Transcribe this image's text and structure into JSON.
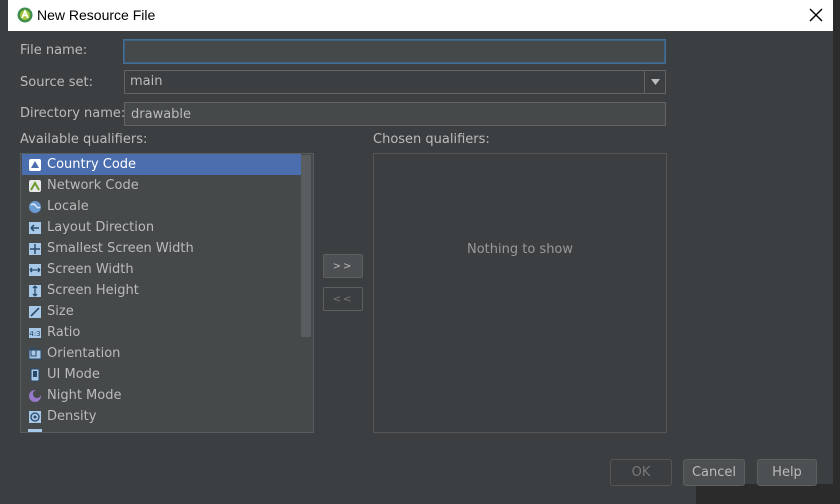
{
  "window": {
    "title": "New Resource File"
  },
  "form": {
    "file_name_label": "File name:",
    "file_name_value": "",
    "source_set_label": "Source set:",
    "source_set_value": "main",
    "directory_name_label": "Directory name:",
    "directory_name_value": "drawable"
  },
  "qualifiers": {
    "available_label": "Available qualifiers:",
    "chosen_label": "Chosen qualifiers:",
    "empty_text": "Nothing to show",
    "items": [
      {
        "label": "Country Code",
        "icon": "country-code-icon"
      },
      {
        "label": "Network Code",
        "icon": "network-code-icon"
      },
      {
        "label": "Locale",
        "icon": "globe-icon"
      },
      {
        "label": "Layout Direction",
        "icon": "layout-direction-icon"
      },
      {
        "label": "Smallest Screen Width",
        "icon": "smallest-screen-width-icon"
      },
      {
        "label": "Screen Width",
        "icon": "screen-width-icon"
      },
      {
        "label": "Screen Height",
        "icon": "screen-height-icon"
      },
      {
        "label": "Size",
        "icon": "size-icon"
      },
      {
        "label": "Ratio",
        "icon": "ratio-icon"
      },
      {
        "label": "Orientation",
        "icon": "orientation-icon"
      },
      {
        "label": "UI Mode",
        "icon": "ui-mode-icon"
      },
      {
        "label": "Night Mode",
        "icon": "night-mode-icon"
      },
      {
        "label": "Density",
        "icon": "density-icon"
      }
    ],
    "add_button": ">>",
    "remove_button": "<<"
  },
  "buttons": {
    "ok": "OK",
    "cancel": "Cancel",
    "help": "Help"
  },
  "colors": {
    "selection": "#4b6eaf",
    "background": "#3c3f41",
    "accent_focus": "#466d94"
  }
}
